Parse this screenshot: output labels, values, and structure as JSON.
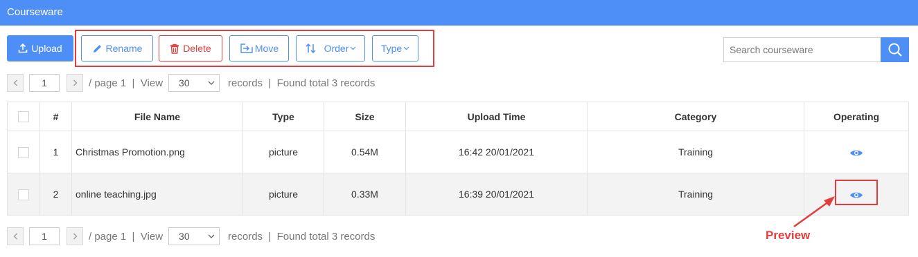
{
  "app": {
    "title": "Courseware"
  },
  "toolbar": {
    "upload_label": "Upload",
    "rename_label": "Rename",
    "delete_label": "Delete",
    "move_label": "Move",
    "order_label": "Order",
    "type_label": "Type"
  },
  "search": {
    "placeholder": "Search courseware"
  },
  "pager": {
    "page": "1",
    "page_suffix": "/ page 1  |  View",
    "per_page": "30",
    "records_text": "records  |  Found total 3 records"
  },
  "table": {
    "headers": [
      "#",
      "File Name",
      "Type",
      "Size",
      "Upload Time",
      "Category",
      "Operating"
    ],
    "rows": [
      {
        "index": "1",
        "file_name": "Christmas Promotion.png",
        "type": "picture",
        "size": "0.54M",
        "upload_time": "16:42 20/01/2021",
        "category": "Training"
      },
      {
        "index": "2",
        "file_name": "online teaching.jpg",
        "type": "picture",
        "size": "0.33M",
        "upload_time": "16:39 20/01/2021",
        "category": "Training"
      }
    ]
  },
  "annotation": {
    "label": "Preview"
  },
  "colors": {
    "accent": "#4d8ef7",
    "danger": "#e03b3b",
    "annotation": "#e43c3c"
  },
  "icons": [
    "upload-icon",
    "pencil-icon",
    "trash-icon",
    "move-icon",
    "sort-icon",
    "chevron-down-icon",
    "search-icon",
    "eye-icon"
  ]
}
